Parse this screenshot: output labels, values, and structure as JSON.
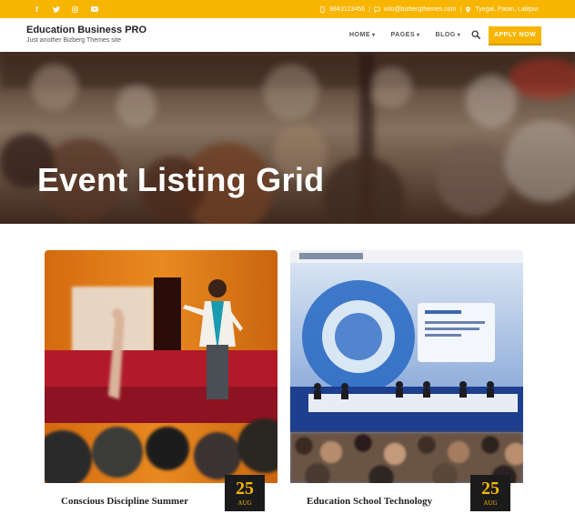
{
  "topbar": {
    "social_icons": [
      "facebook-icon",
      "twitter-icon",
      "instagram-icon",
      "youtube-icon"
    ],
    "phone": "9843123456",
    "email": "info@bizbergthemes.com",
    "address": "Tyegal, Patan, Lalitpur",
    "colors": {
      "bar": "#f7b500"
    }
  },
  "header": {
    "site_title": "Education Business PRO",
    "tagline": "Just another Bizberg Themes site",
    "nav": [
      {
        "label": "HOME"
      },
      {
        "label": "PAGES"
      },
      {
        "label": "BLOG"
      }
    ],
    "apply_label": "APPLY NOW",
    "colors": {
      "accent": "#f7b500"
    }
  },
  "hero": {
    "title": "Event Listing Grid"
  },
  "events": [
    {
      "day": "25",
      "month": "AUG",
      "title": "Conscious Discipline Summer"
    },
    {
      "day": "25",
      "month": "AUG",
      "title": "Education School Technology"
    }
  ]
}
